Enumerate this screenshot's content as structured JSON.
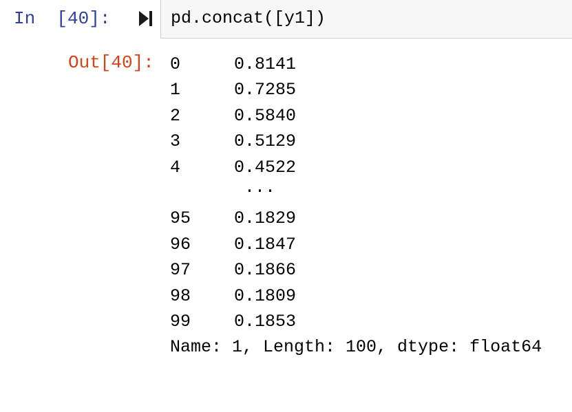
{
  "input_cell": {
    "prompt": "In  [40]:",
    "code": "pd.concat([y1])"
  },
  "run_icon": "run-cell-icon",
  "output_cell": {
    "prompt": "Out[40]:",
    "rows": [
      {
        "index": "0",
        "value": "0.8141"
      },
      {
        "index": "1",
        "value": "0.7285"
      },
      {
        "index": "2",
        "value": "0.5840"
      },
      {
        "index": "3",
        "value": "0.5129"
      },
      {
        "index": "4",
        "value": "0.4522"
      },
      {
        "index": "",
        "value": "..."
      },
      {
        "index": "95",
        "value": "0.1829"
      },
      {
        "index": "96",
        "value": "0.1847"
      },
      {
        "index": "97",
        "value": "0.1866"
      },
      {
        "index": "98",
        "value": "0.1809"
      },
      {
        "index": "99",
        "value": "0.1853"
      }
    ],
    "footer": "Name: 1, Length: 100, dtype: float64"
  },
  "colors": {
    "in_prompt": "#303f9f",
    "out_prompt": "#d84315",
    "input_bg": "#f7f7f7",
    "input_border": "#cfcfcf"
  }
}
